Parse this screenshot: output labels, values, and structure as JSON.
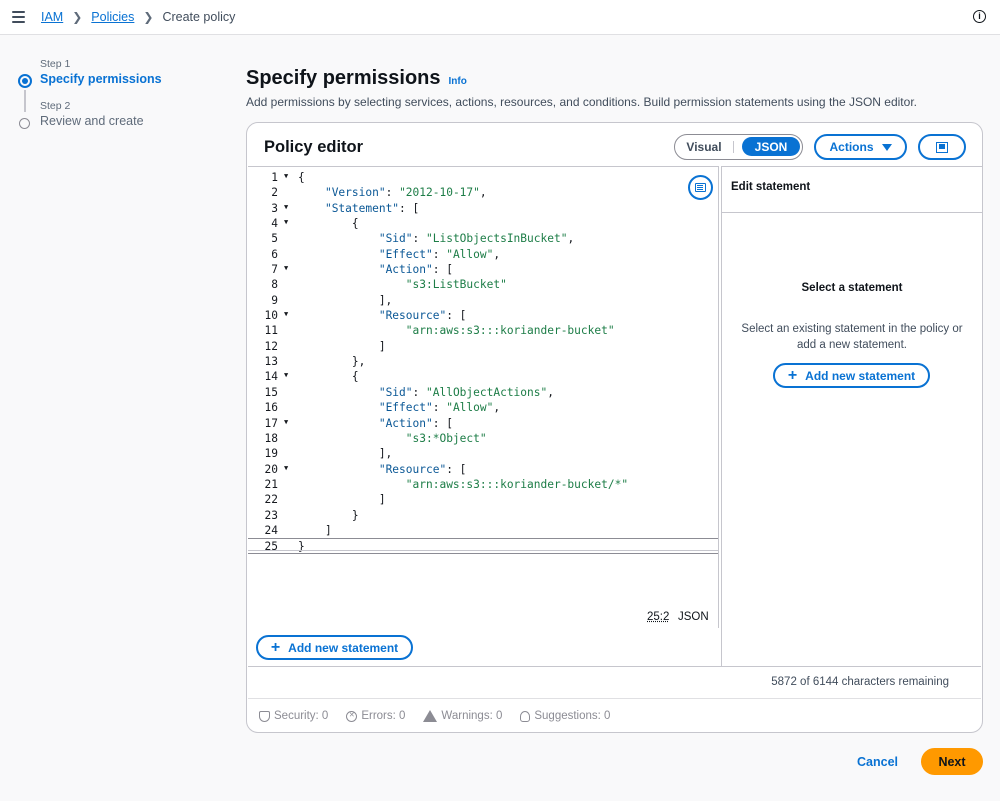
{
  "breadcrumb": {
    "iam": "IAM",
    "policies": "Policies",
    "current": "Create policy"
  },
  "steps": [
    {
      "label": "Step 1",
      "title": "Specify permissions"
    },
    {
      "label": "Step 2",
      "title": "Review and create"
    }
  ],
  "header": {
    "title": "Specify permissions",
    "info": "Info",
    "description": "Add permissions by selecting services, actions, resources, and conditions. Build permission statements using the JSON editor."
  },
  "editor": {
    "title": "Policy editor",
    "mode_visual": "Visual",
    "mode_json": "JSON",
    "actions_label": "Actions",
    "cursor_position": "25:2",
    "language": "JSON",
    "add_statement_label": "Add new statement",
    "lines": [
      "{",
      "    \"Version\": \"2012-10-17\",",
      "    \"Statement\": [",
      "        {",
      "            \"Sid\": \"ListObjectsInBucket\",",
      "            \"Effect\": \"Allow\",",
      "            \"Action\": [",
      "                \"s3:ListBucket\"",
      "            ],",
      "            \"Resource\": [",
      "                \"arn:aws:s3:::koriander-bucket\"",
      "            ]",
      "        },",
      "        {",
      "            \"Sid\": \"AllObjectActions\",",
      "            \"Effect\": \"Allow\",",
      "            \"Action\": [",
      "                \"s3:*Object\"",
      "            ],",
      "            \"Resource\": [",
      "                \"arn:aws:s3:::koriander-bucket/*\"",
      "            ]",
      "        }",
      "    ]",
      "}"
    ],
    "foldable_lines": [
      1,
      3,
      4,
      7,
      10,
      14,
      17,
      20
    ]
  },
  "side_panel": {
    "title": "Edit statement",
    "select_title": "Select a statement",
    "select_desc": "Select an existing statement in the policy or add a new statement.",
    "add_statement_label": "Add new statement"
  },
  "footer": {
    "chars_remaining": "5872 of 6144 characters remaining",
    "security": "Security: 0",
    "errors": "Errors: 0",
    "warnings": "Warnings: 0",
    "suggestions": "Suggestions: 0"
  },
  "buttons": {
    "cancel": "Cancel",
    "next": "Next"
  },
  "colors": {
    "accent": "#0972d3",
    "primary_button": "#ff9900",
    "json_key": "#0b5896",
    "json_string": "#1d7d47"
  }
}
